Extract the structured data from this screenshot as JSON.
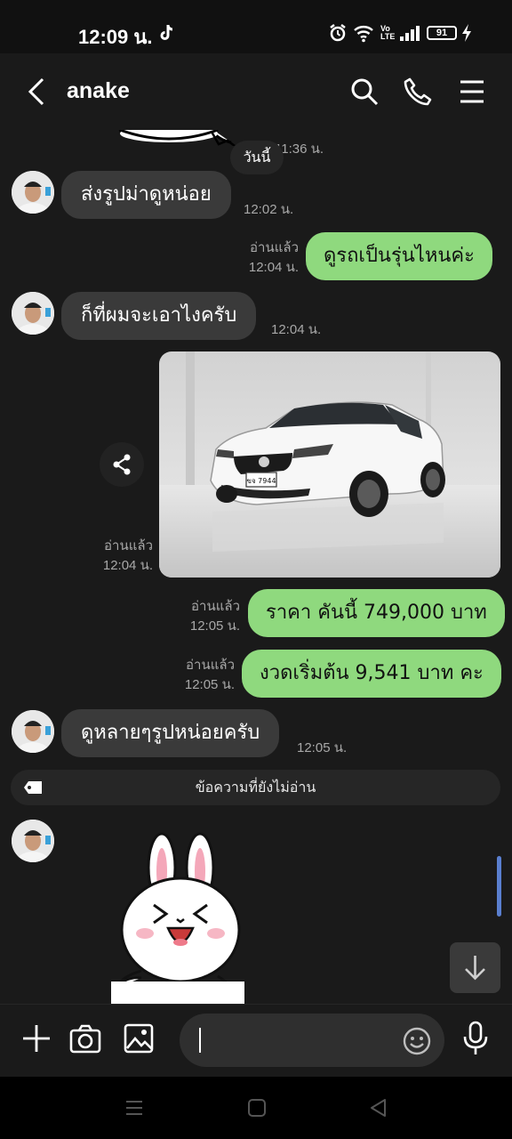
{
  "status": {
    "time": "12:09 น.",
    "battery": "91"
  },
  "header": {
    "contact_name": "anake"
  },
  "chat": {
    "prev_time": "11:36 น.",
    "date_chip": "วันนี้",
    "messages": [
      {
        "dir": "in",
        "text": "ส่งรูปม่าดูหน่อย",
        "time": "12:02 น."
      },
      {
        "dir": "out",
        "text": "ดูรถเป็นรุ่นไหนค่ะ",
        "read": "อ่านแล้ว",
        "time": "12:04 น."
      },
      {
        "dir": "in",
        "text": "ก็ที่ผมจะเอาไงครับ",
        "time": "12:04 น."
      },
      {
        "dir": "out",
        "type": "image",
        "plate": "ขจ 7944",
        "read": "อ่านแล้ว",
        "time": "12:04 น."
      },
      {
        "dir": "out",
        "text": "ราคา คันนี้ 749,000 บาท",
        "read": "อ่านแล้ว",
        "time": "12:05 น."
      },
      {
        "dir": "out",
        "text": "งวดเริ่มต้น 9,541 บาท คะ",
        "read": "อ่านแล้ว",
        "time": "12:05 น."
      },
      {
        "dir": "in",
        "text": "ดูหลายๆรูปหน่อยครับ",
        "time": "12:05 น."
      }
    ],
    "unread_divider": "ข้อความที่ยังไม่อ่าน"
  }
}
